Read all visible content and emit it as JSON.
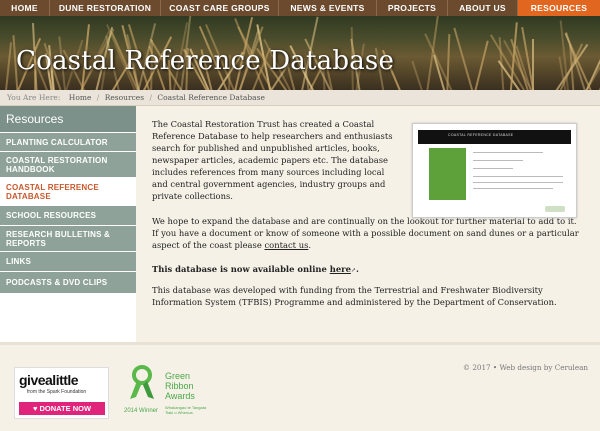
{
  "nav": {
    "items": [
      {
        "label": "HOME"
      },
      {
        "label": "DUNE RESTORATION"
      },
      {
        "label": "COAST CARE GROUPS"
      },
      {
        "label": "NEWS & EVENTS"
      },
      {
        "label": "PROJECTS"
      },
      {
        "label": "ABOUT US"
      },
      {
        "label": "RESOURCES"
      }
    ],
    "active_color": "#e1661f"
  },
  "hero": {
    "title": "Coastal Reference Database"
  },
  "breadcrumb": {
    "label": "You Are Here:",
    "items": [
      "Home",
      "Resources",
      "Coastal Reference Database"
    ]
  },
  "sidebar": {
    "heading": "Resources",
    "items": [
      {
        "label": "PLANTING CALCULATOR"
      },
      {
        "label": "COASTAL RESTORATION HANDBOOK"
      },
      {
        "label": "COASTAL REFERENCE DATABASE"
      },
      {
        "label": "SCHOOL RESOURCES"
      },
      {
        "label": "RESEARCH BULLETINS & REPORTS"
      },
      {
        "label": "LINKS"
      },
      {
        "label": "PODCASTS & DVD CLIPS"
      }
    ]
  },
  "content": {
    "para1": "The Coastal Restoration Trust has created a Coastal Reference Database to help researchers and enthusiasts search for published and unpublished articles, books, newspaper articles, academic papers etc. The database includes references from many sources including local and central government agencies, industry groups and private collections.",
    "para2_text": "We hope to expand the database and are continually on the lookout for further material to add to it. If you have a document or know of someone with a possible document on sand dunes or a particular aspect of the coast please",
    "para2_link": "contact us",
    "para2_end": ".",
    "para3_text": "This database is now available online",
    "para3_link": "here",
    "para3_end": ".",
    "para4": "This database was developed with funding from the Terrestrial and Freshwater Biodiversity Information System (TFBIS) Programme and administered by the Department of Conservation.",
    "thumb_title": "COASTAL REFERENCE DATABASE"
  },
  "footer": {
    "givealittle": "givealittle",
    "givealittle_from": "from the Spark Foundation",
    "donate_label": "DONATE NOW",
    "green_ribbon": "Green Ribbon Awards",
    "green_ribbon_winner": "2014 Winner",
    "green_ribbon_sub": "Whakangao te Tangata Tiaki o Whenua",
    "copyright": "© 2017",
    "sep": "•",
    "credit": "Web design by Cerulean"
  }
}
